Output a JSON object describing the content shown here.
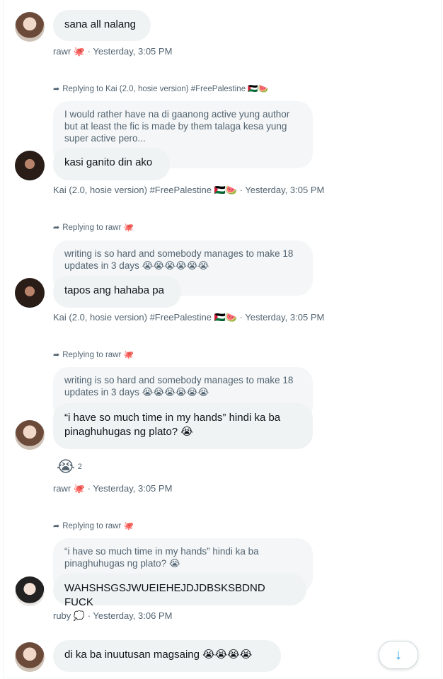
{
  "messages": [
    {
      "text": "sana all nalang",
      "meta": "rawr 🐙 · Yesterday, 3:05 PM"
    },
    {
      "reply_to": "Replying to Kai (2.0, hosie version) #FreePalestine 🇵🇸🍉",
      "quote": "I would rather have na di gaanong active yung author\nbut at least the fic is made by them talaga kesa yung\nsuper active pero...",
      "text": "kasi ganito din ako",
      "meta": "Kai (2.0, hosie version) #FreePalestine 🇵🇸🍉 · Yesterday, 3:05 PM"
    },
    {
      "reply_to": "Replying to rawr 🐙",
      "quote": "writing is so hard and somebody manages to make 18\nupdates in 3 days 😭😭😭😭😭😭",
      "text": "tapos ang hahaba pa",
      "meta": "Kai (2.0, hosie version) #FreePalestine 🇵🇸🍉 · Yesterday, 3:05 PM"
    },
    {
      "reply_to": "Replying to rawr 🐙",
      "quote": "writing is so hard and somebody manages to make 18\nupdates in 3 days 😭😭😭😭😭😭",
      "text": "“i have so much time in my hands” hindi ka ba\npinaghuhugas ng plato? 😭",
      "reaction_emoji": "😭",
      "reaction_count": "2",
      "meta": "rawr 🐙 · Yesterday, 3:05 PM"
    },
    {
      "reply_to": "Replying to rawr 🐙",
      "quote": "“i have so much time in my hands” hindi ka ba\npinaghuhugas ng plato? 😭",
      "text": "WAHSHSGSJWUEIEHEJDJDBSKSBDND FUCK",
      "meta": "ruby 💭 · Yesterday, 3:06 PM"
    },
    {
      "text": "di ka ba inuutusan magsaing 😭😭😭😭"
    }
  ],
  "icons": {
    "reply": "reply-arrow-icon",
    "scroll": "arrow-down-icon"
  },
  "colors": {
    "bubble": "#eff3f4",
    "meta": "#536471",
    "accent": "#1d9bf0"
  }
}
